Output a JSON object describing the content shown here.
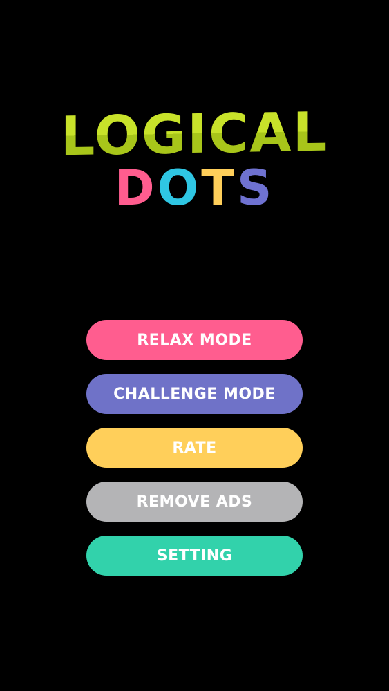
{
  "logo": {
    "line1": "LOGICAL",
    "line2_letters": [
      {
        "char": "D",
        "color": "#ff5d8f"
      },
      {
        "char": "O",
        "color": "#2fc6e3"
      },
      {
        "char": "T",
        "color": "#ffcf5a"
      },
      {
        "char": "S",
        "color": "#6f72d1"
      }
    ]
  },
  "menu": [
    {
      "label": "RELAX MODE",
      "color": "#ff5d8f"
    },
    {
      "label": "CHALLENGE MODE",
      "color": "#6f72c8"
    },
    {
      "label": "RATE",
      "color": "#ffcf5a"
    },
    {
      "label": "REMOVE ADS",
      "color": "#b4b4b6"
    },
    {
      "label": "SETTING",
      "color": "#32d2ab"
    }
  ]
}
